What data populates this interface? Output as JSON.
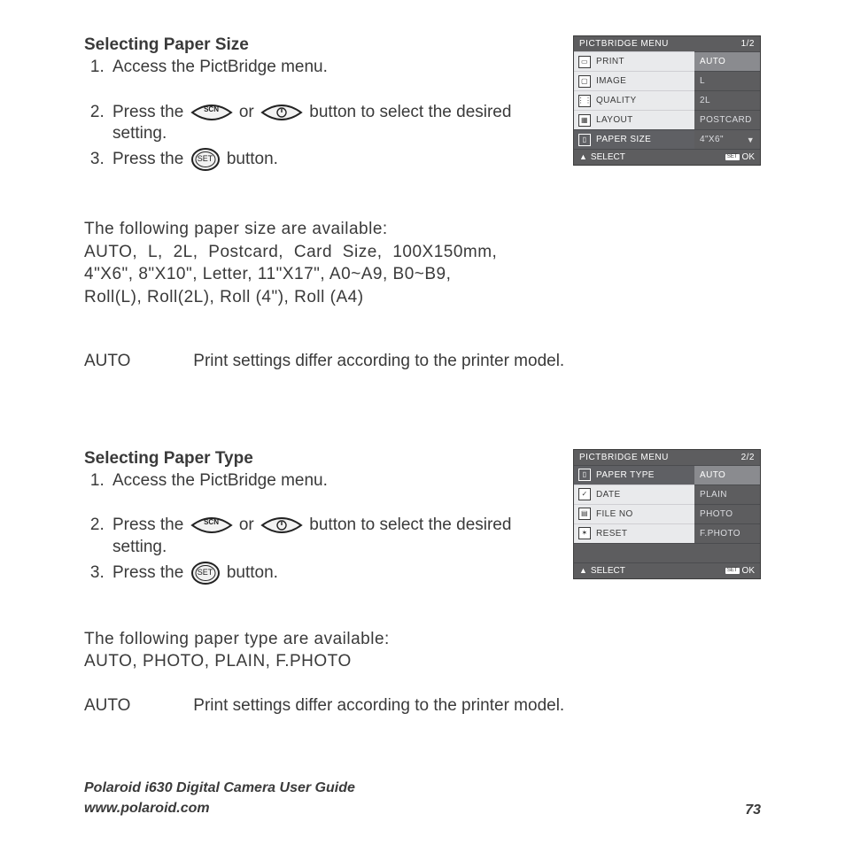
{
  "section1": {
    "heading": "Selecting Paper Size",
    "step1": "Access the PictBridge menu.",
    "step2_a": "Press the",
    "step2_mid": "or",
    "step2_b": "button to select the desired setting.",
    "step3_a": "Press the",
    "step3_b": "button.",
    "scn_label": "SCN",
    "set_label": "SET",
    "para_lead": "The following paper size are available:",
    "para_line1": "AUTO, L, 2L, Postcard, Card Size, 100X150mm,",
    "para_line2": "4\"X6\", 8\"X10\", Letter, 11\"X17\", A0~A9, B0~B9,",
    "para_line3": "Roll(L), Roll(2L), Roll (4\"), Roll (A4)",
    "auto_lbl": "AUTO",
    "auto_text": "Print settings differ according to the printer model."
  },
  "menu1": {
    "title": "PICTBRIDGE MENU",
    "page": "1/2",
    "rows": [
      "PRINT",
      "IMAGE",
      "QUALITY",
      "LAYOUT",
      "PAPER SIZE"
    ],
    "vals": [
      "AUTO",
      "L",
      "2L",
      "POSTCARD",
      "4\"X6\""
    ],
    "select": "SELECT",
    "ok": "OK"
  },
  "section2": {
    "heading": "Selecting Paper Type",
    "step1": "Access the PictBridge menu.",
    "step2_a": "Press the",
    "step2_mid": "or",
    "step2_b": "button to select the desired setting.",
    "step3_a": "Press the",
    "step3_b": "button.",
    "scn_label": "SCN",
    "set_label": "SET",
    "para_lead": "The following paper type are available:",
    "para_line1": "AUTO, PHOTO, PLAIN, F.PHOTO",
    "auto_lbl": "AUTO",
    "auto_text": "Print settings differ according to the printer model."
  },
  "menu2": {
    "title": "PICTBRIDGE MENU",
    "page": "2/2",
    "rows": [
      "PAPER TYPE",
      "DATE",
      "FILE NO",
      "RESET"
    ],
    "vals": [
      "AUTO",
      "PLAIN",
      "PHOTO",
      "F.PHOTO"
    ],
    "select": "SELECT",
    "ok": "OK"
  },
  "footer": {
    "title": "Polaroid i630 Digital Camera User Guide",
    "url": "www.polaroid.com",
    "page": "73"
  }
}
